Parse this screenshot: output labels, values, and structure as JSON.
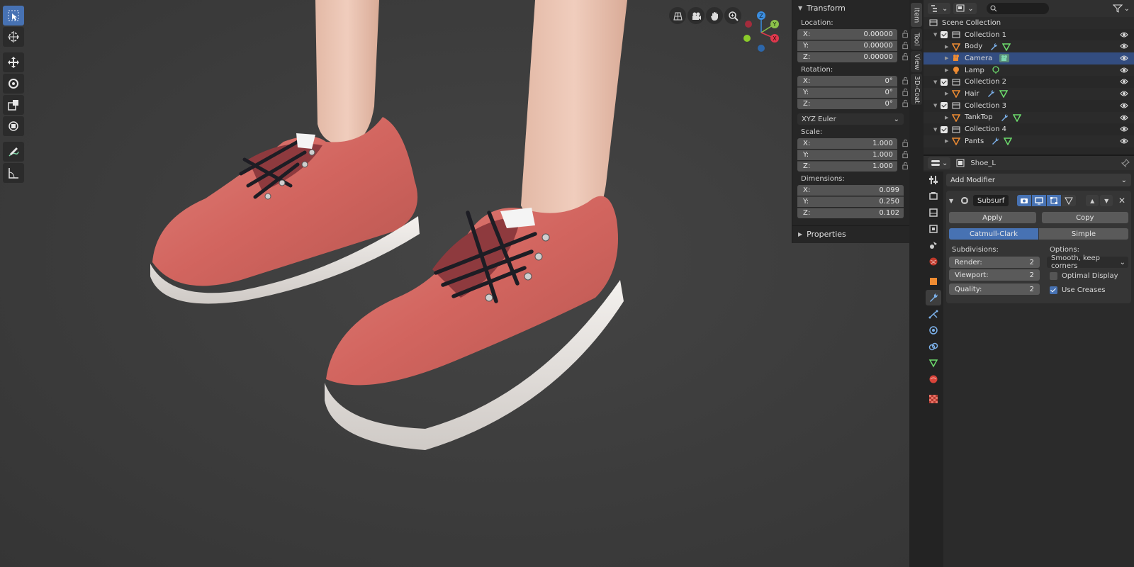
{
  "viewport": {
    "tools": [
      "select-box",
      "cursor",
      "move",
      "rotate",
      "scale",
      "transform",
      "annotate",
      "measure"
    ],
    "nav_icons": [
      "grid-icon",
      "camera-icon",
      "hand-icon",
      "zoom-icon"
    ],
    "gizmo": {
      "z": "Z",
      "y": "Y",
      "x": "X"
    }
  },
  "npanel": {
    "transform_label": "Transform",
    "location_label": "Location:",
    "location": [
      {
        "axis": "X:",
        "value": "0.00000"
      },
      {
        "axis": "Y:",
        "value": "0.00000"
      },
      {
        "axis": "Z:",
        "value": "0.00000"
      }
    ],
    "rotation_label": "Rotation:",
    "rotation": [
      {
        "axis": "X:",
        "value": "0°"
      },
      {
        "axis": "Y:",
        "value": "0°"
      },
      {
        "axis": "Z:",
        "value": "0°"
      }
    ],
    "rotation_mode": "XYZ Euler",
    "scale_label": "Scale:",
    "scale": [
      {
        "axis": "X:",
        "value": "1.000"
      },
      {
        "axis": "Y:",
        "value": "1.000"
      },
      {
        "axis": "Z:",
        "value": "1.000"
      }
    ],
    "dimensions_label": "Dimensions:",
    "dimensions": [
      {
        "axis": "X:",
        "value": "0.099"
      },
      {
        "axis": "Y:",
        "value": "0.250"
      },
      {
        "axis": "Z:",
        "value": "0.102"
      }
    ],
    "properties_label": "Properties"
  },
  "sidetabs": [
    "Item",
    "Tool",
    "View",
    "3D-Coat"
  ],
  "outliner": {
    "rows": [
      {
        "label": "Scene Collection",
        "type": "scene"
      },
      {
        "label": "Collection 1",
        "type": "collection"
      },
      {
        "label": "Body",
        "type": "mesh"
      },
      {
        "label": "Camera",
        "type": "camera"
      },
      {
        "label": "Lamp",
        "type": "light"
      },
      {
        "label": "Collection 2",
        "type": "collection"
      },
      {
        "label": "Hair",
        "type": "mesh"
      },
      {
        "label": "Collection 3",
        "type": "collection"
      },
      {
        "label": "TankTop",
        "type": "mesh"
      },
      {
        "label": "Collection 4",
        "type": "collection"
      },
      {
        "label": "Pants",
        "type": "mesh"
      }
    ]
  },
  "properties": {
    "object_name": "Shoe_L",
    "add_modifier": "Add Modifier",
    "modifier_name": "Subsurf",
    "apply": "Apply",
    "copy": "Copy",
    "catmull": "Catmull-Clark",
    "simple": "Simple",
    "subdivisions_label": "Subdivisions:",
    "render_label": "Render:",
    "render_value": "2",
    "viewport_label": "Viewport:",
    "viewport_value": "2",
    "quality_label": "Quality:",
    "quality_value": "2",
    "options_label": "Options:",
    "options_value": "Smooth, keep corners",
    "optimal_display": "Optimal Display",
    "use_creases": "Use Creases"
  }
}
